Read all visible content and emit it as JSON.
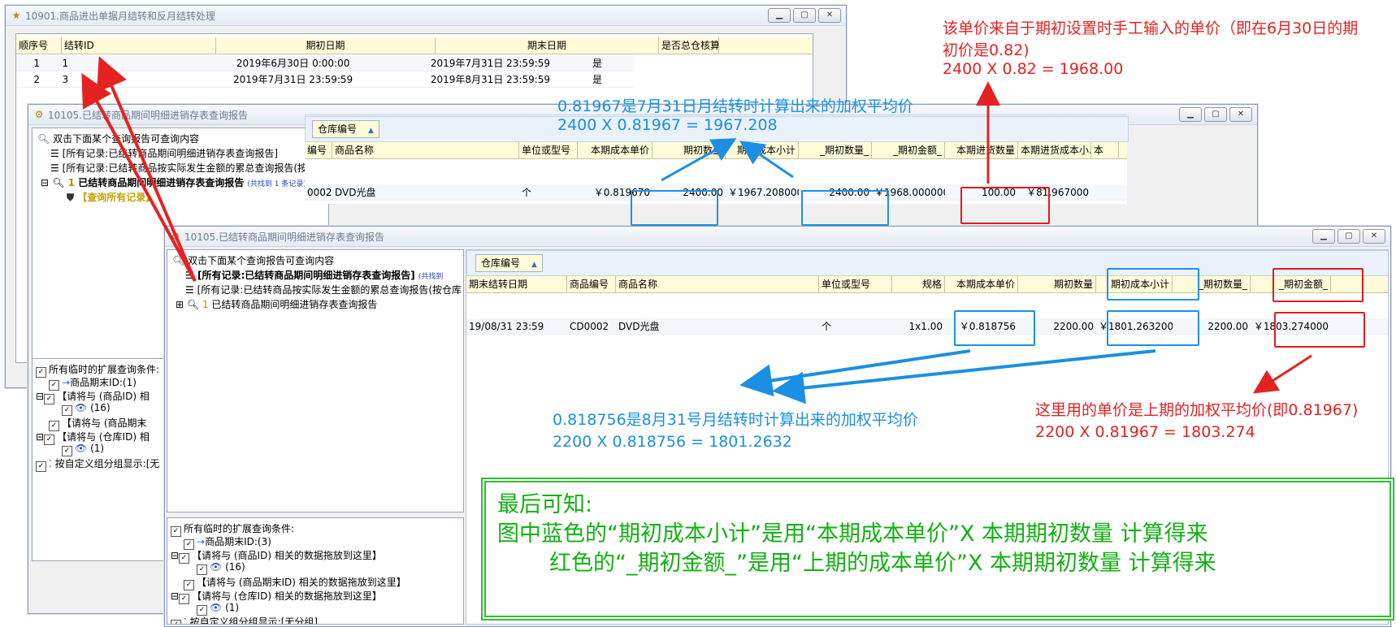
{
  "win1": {
    "title": "10901.商品进出单据月结转和反月结转处理",
    "headers": [
      "顺序号",
      "结转ID",
      "期初日期",
      "期末日期",
      "是否总仓核算"
    ],
    "rows": [
      [
        "1",
        "1",
        "2019年6月30日 0:00:00",
        "2019年7月31日 23:59:59",
        "是"
      ],
      [
        "2",
        "3",
        "2019年7月31日 23:59:59",
        "2019年8月31日 23:59:59",
        "是"
      ]
    ]
  },
  "win2": {
    "title": "10105.已结转商品期间明细进销存表查询报告",
    "tree": {
      "root": "双击下面某个查询报告可查询内容",
      "item1": "[所有记录:已结转商品期间明细进销存表查询报告]",
      "item2": "[所有记录:已结转商品按实际发生金额的累总查询报告(按仓库",
      "item3_num": "1",
      "item3": "已结转商品期间明细进销存表查询报告",
      "item3_count": "(共找到 1 条记录)",
      "item4": "【查询所有记录】"
    },
    "chip": "仓库编号",
    "headers": [
      "编号",
      "商品名称",
      "单位或型号",
      "本期成本单价",
      "期初数量",
      "期初成本小计",
      "_期初数量_",
      "_期初金额_",
      "本期进货数量",
      "本期进货成本小...",
      "本"
    ],
    "row": [
      "0002",
      "DVD光盘",
      "个",
      "￥0.819670",
      "2400.00",
      "￥1967.208000",
      "2400.00",
      "￥1968.000000",
      "100.00",
      "￥81.967000",
      ""
    ],
    "cond": {
      "title": "所有临时的扩展查询条件:",
      "c1": "商品期末ID:(1)",
      "c2": "【请将与 (商品ID) 相",
      "c2v": "(16)",
      "c3": "【请将与 (商品期末",
      "c4": "【请将与 (仓库ID) 相",
      "c4v": "(1)",
      "c5": "按自定义组分组显示:[无"
    }
  },
  "win3": {
    "title": "10105.已结转商品期间明细进销存表查询报告",
    "tree": {
      "root": "双击下面某个查询报告可查询内容",
      "item1": "[所有记录:已结转商品期间明细进销存表查询报告]",
      "item1_count": "(共找到",
      "item2": "[所有记录:已结转商品按实际发生金额的累总查询报告(按仓库",
      "item3_num": "1",
      "item3": "已结转商品期间明细进销存表查询报告"
    },
    "chip": "仓库编号",
    "headers": [
      "期末结转日期",
      "商品编号",
      "商品名称",
      "单位或型号",
      "规格",
      "本期成本单价",
      "期初数量",
      "期初成本小计",
      "_期初数量_",
      "_期初金额_"
    ],
    "row": [
      "19/08/31 23:59",
      "CD0002",
      "DVD光盘",
      "个",
      "1x1.00",
      "￥0.818756",
      "2200.00",
      "￥1801.263200",
      "2200.00",
      "￥1803.274000"
    ],
    "cond": {
      "title": "所有临时的扩展查询条件:",
      "c1": "商品期末ID:(3)",
      "c2": "【请将与 (商品ID) 相关的数据拖放到这里】",
      "c2v": "(16)",
      "c3": "【请将与 (商品期末ID) 相关的数据拖放到这里】",
      "c4": "【请将与 (仓库ID) 相关的数据拖放到这里】",
      "c4v": "(1)",
      "c5": "按自定义组分组显示:[无分组]"
    }
  },
  "notes": {
    "red_top_1": "该单价来自于期初设置时手工输入的单价（即在6月30日的期",
    "red_top_2": "初价是0.82)",
    "red_top_3": "2400 X 0.82 = 1968.00",
    "blue_top_1": "0.81967是7月31日月结转时计算出来的加权平均价",
    "blue_top_2": "2400 X 0.81967 = 1967.208",
    "blue_mid_1": "0.818756是8月31号月结转时计算出来的加权平均价",
    "blue_mid_2": "2200 X 0.818756 = 1801.2632",
    "red_mid_1": "这里用的单价是上期的加权平均价(即0.81967)",
    "red_mid_2": "2200 X 0.81967 = 1803.274",
    "summary_1": "最后可知:",
    "summary_2": "图中蓝色的“期初成本小计”是用“本期成本单价”X 本期期初数量 计算得来",
    "summary_3": "红色的“_期初金额_”是用“上期的成本单价”X 本期期初数量 计算得来"
  },
  "colors": {
    "red": "#e52222",
    "blue": "#1a8fe3",
    "green": "#12b012"
  }
}
